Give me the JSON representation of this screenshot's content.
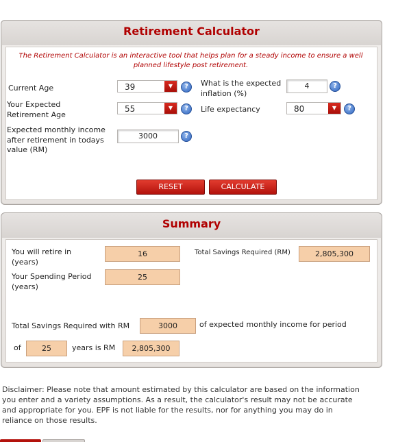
{
  "calculator": {
    "title": "Retirement Calculator",
    "description_line1": "The Retirement Calculator is an interactive tool that helps plan for a steady income to ensure a well",
    "description_line2": "planned lifestyle post retirement.",
    "current_age_label": "Current Age",
    "current_age_value": "39",
    "retirement_age_label_line1": "Your Expected",
    "retirement_age_label_line2": "Retirement Age",
    "retirement_age_value": "55",
    "monthly_income_label_line1": "Expected monthly income",
    "monthly_income_label_line2": "after retirement in todays",
    "monthly_income_label_line3": "value (RM)",
    "monthly_income_value": "3000",
    "inflation_label_line1": "What is the expected",
    "inflation_label_line2": "inflation (%)",
    "inflation_value": "4",
    "life_expectancy_label": "Life expectancy",
    "life_expectancy_value": "80",
    "reset_label": "RESET",
    "calculate_label": "CALCULATE"
  },
  "summary": {
    "title": "Summary",
    "retire_in_label_line1": "You will retire in",
    "retire_in_label_line2": "(years)",
    "retire_in_value": "16",
    "spending_label_line1": "Your Spending Period",
    "spending_label_line2": "(years)",
    "spending_value": "25",
    "total_savings_label": "Total Savings Required (RM)",
    "total_savings_value": "2,805,300",
    "sentence_part1": "Total Savings Required with RM",
    "sentence_income": "3000",
    "sentence_part2": "of expected monthly income for period",
    "sentence_part3": "of",
    "sentence_period": "25",
    "sentence_part4": "years is RM",
    "sentence_total": "2,805,300"
  },
  "disclaimer": {
    "line1": "Disclaimer: Please note that amount estimated by this calculator are based on the information",
    "line2": "you enter and a variety assumptions. As a result, the calculator's result may not be accurate",
    "line3": "and appropriate for you. EPF is not liable for the results, nor for anything you may do in",
    "line4": "reliance on those results."
  },
  "icons": {
    "help": "?",
    "dropdown": "▼"
  }
}
